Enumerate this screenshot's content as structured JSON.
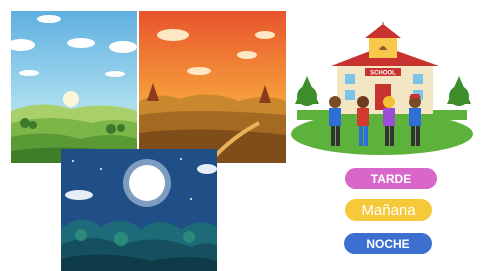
{
  "answers": {
    "tarde": "TARDE",
    "manana": "Mañana",
    "noche": "NOCHE"
  },
  "school": {
    "sign": "SCHOOL"
  },
  "colors": {
    "tarde_button": "#d966c9",
    "manana_button": "#f5c93a",
    "noche_button": "#3d6fd1"
  }
}
